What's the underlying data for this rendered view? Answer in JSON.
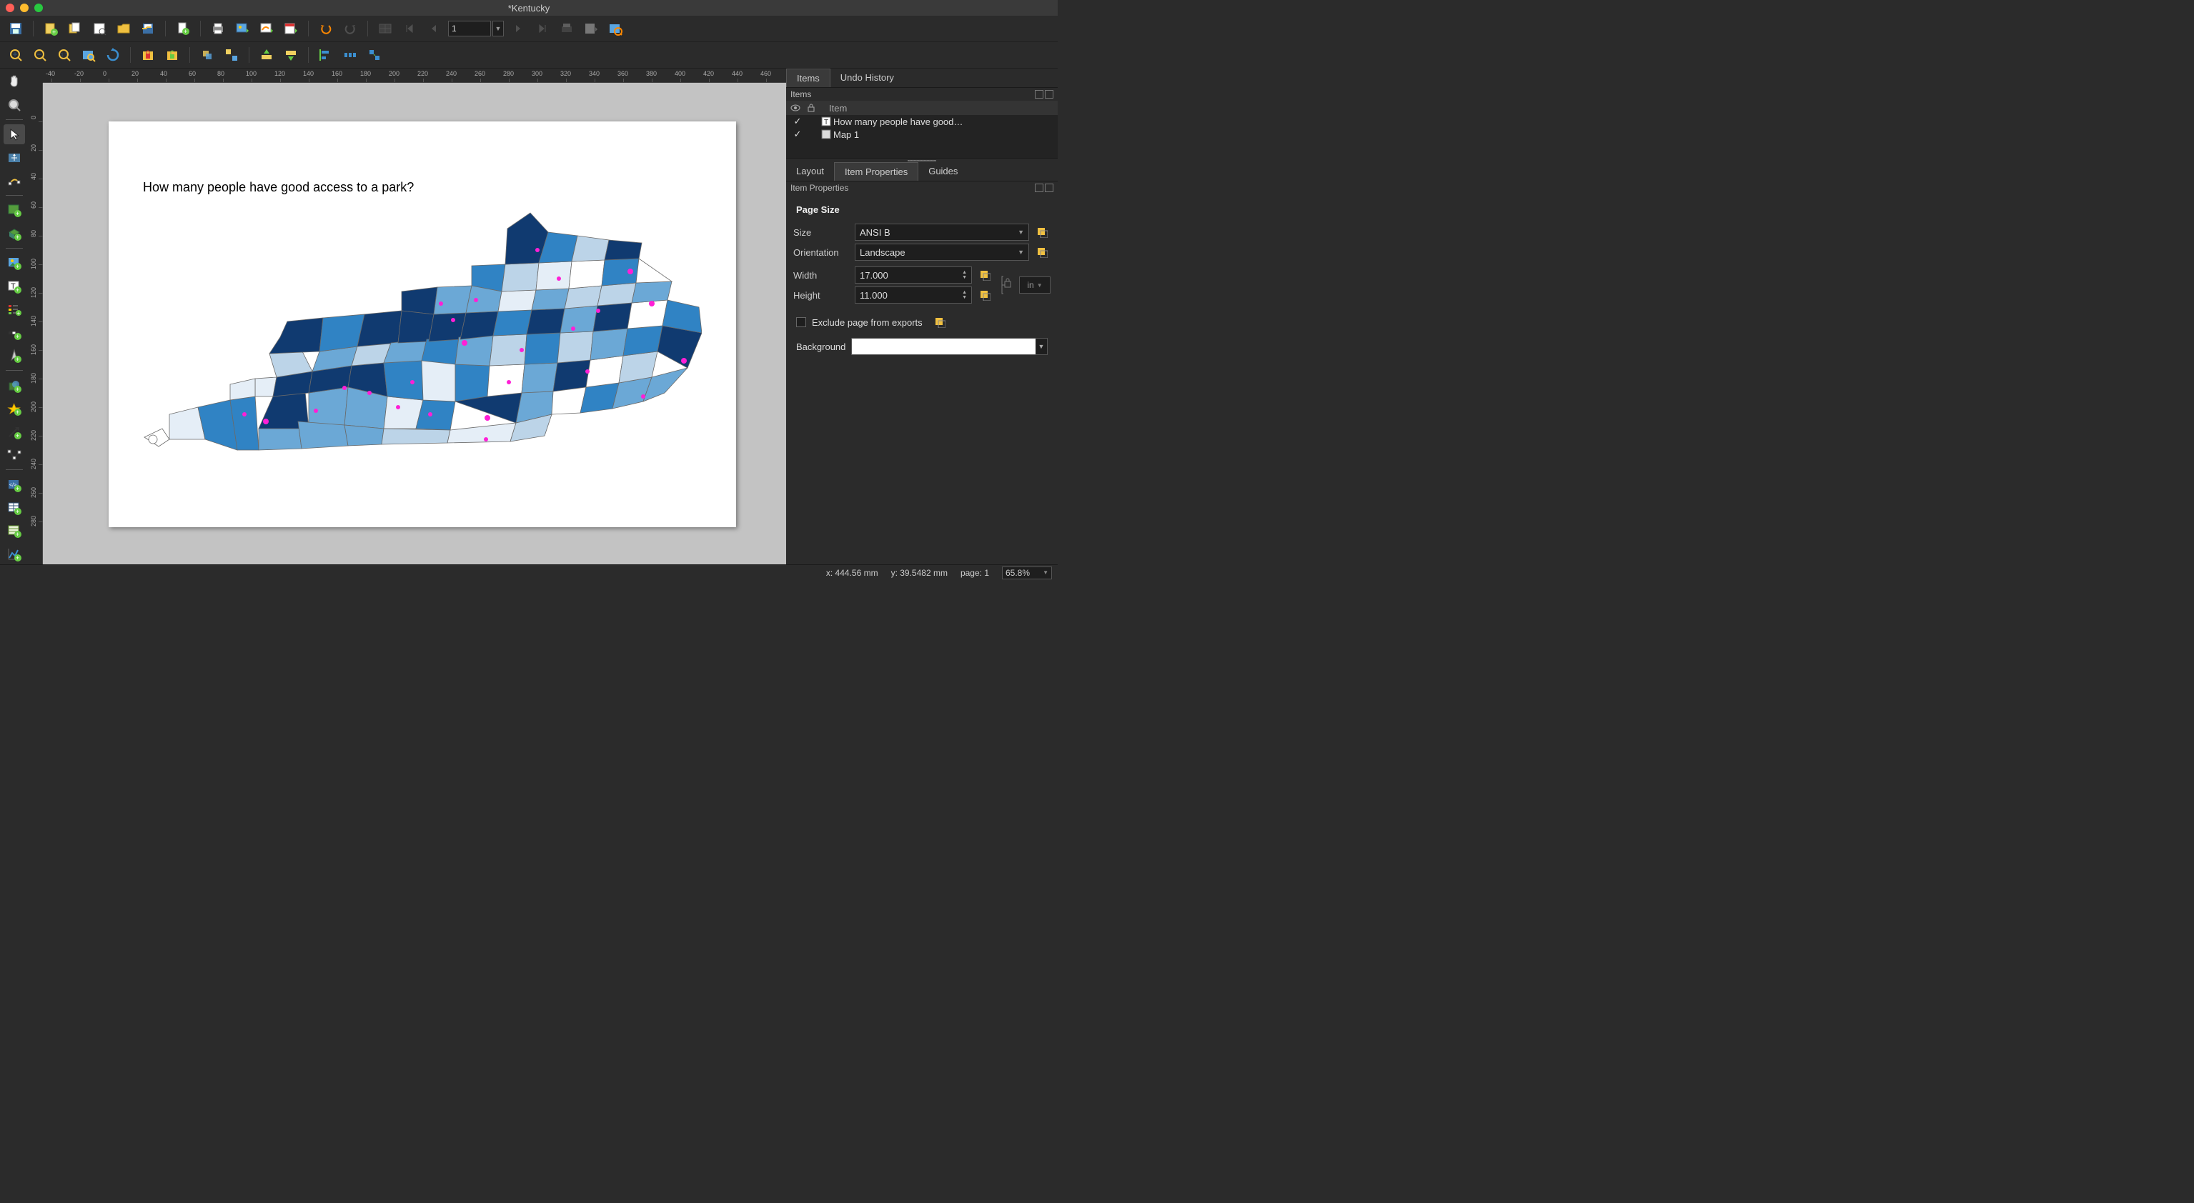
{
  "window": {
    "title": "*Kentucky"
  },
  "toolbar1": {
    "page_number": "1"
  },
  "page": {
    "title": "How many people have good access to a park?"
  },
  "right": {
    "tabs_top": [
      "Items",
      "Undo History"
    ],
    "active_top": 0,
    "items_panel": {
      "title": "Items",
      "header_col": "Item",
      "rows": [
        {
          "visible": "✓",
          "type": "text",
          "label": "How many people have good…"
        },
        {
          "visible": "✓",
          "type": "map",
          "label": "Map 1"
        }
      ]
    },
    "tabs_mid": [
      "Layout",
      "Item Properties",
      "Guides"
    ],
    "active_mid": 1,
    "item_properties": {
      "title": "Item Properties",
      "section": "Page Size",
      "size_label": "Size",
      "size_value": "ANSI B",
      "orientation_label": "Orientation",
      "orientation_value": "Landscape",
      "width_label": "Width",
      "width_value": "17.000",
      "height_label": "Height",
      "height_value": "11.000",
      "unit_value": "in",
      "exclude_label": "Exclude page from exports",
      "background_label": "Background"
    }
  },
  "status": {
    "x_label": "x: 444.56 mm",
    "y_label": "y: 39.5482 mm",
    "page_label": "page: 1",
    "zoom": "65.8%"
  },
  "ruler": {
    "top_marks": [
      -40,
      -20,
      0,
      20,
      40,
      60,
      80,
      100,
      120,
      140,
      160,
      180,
      200,
      220,
      240,
      260,
      280,
      300,
      320,
      340,
      360,
      380,
      400,
      420,
      440,
      460
    ],
    "left_marks": [
      0,
      20,
      40,
      60,
      80,
      100,
      120,
      140,
      160,
      180,
      200,
      220,
      240,
      260,
      280
    ]
  }
}
